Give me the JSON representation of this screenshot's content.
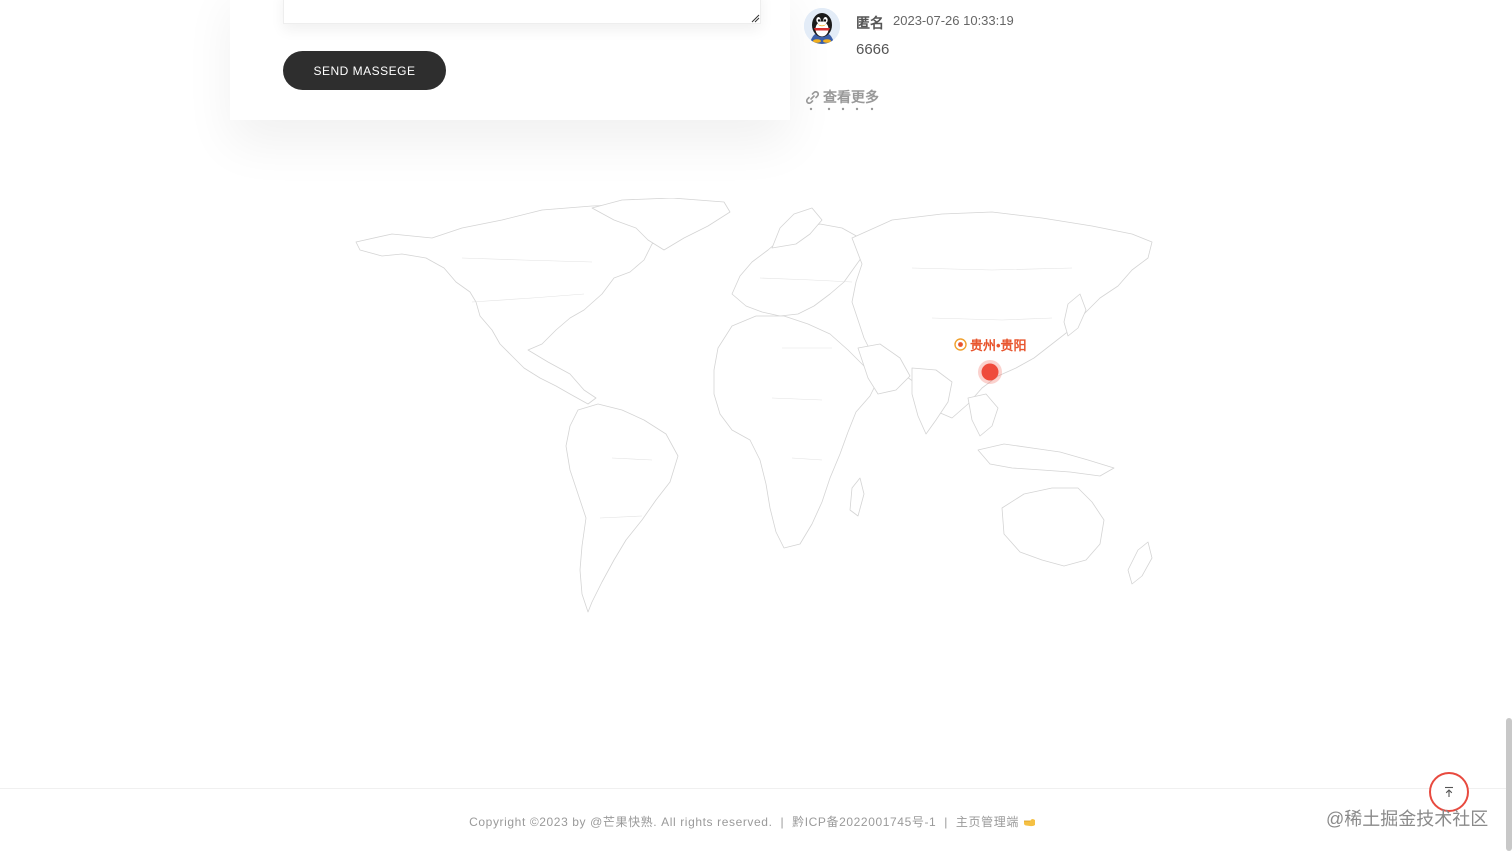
{
  "form": {
    "message_value": "",
    "send_label": "SEND MASSEGE"
  },
  "comment": {
    "author": "匿名",
    "time": "2023-07-26 10:33:19",
    "content": "6666"
  },
  "view_more": {
    "label": "查看更多",
    "icon": "link-icon"
  },
  "map": {
    "location_label": "贵州•贵阳",
    "marker_icon": "location-target-icon",
    "marker_color": "#ef4b3c",
    "label_color": "#e8552e"
  },
  "footer": {
    "copyright": "Copyright ©2023 by @芒果快熟. All rights reserved.",
    "separator": "|",
    "icp": "黔ICP备2022001745号-1",
    "admin_link": "主页管理端",
    "admin_icon": "pointing-hand-icon"
  },
  "back_to_top": {
    "icon": "arrow-up-to-top-icon",
    "color": "#e84a3f"
  },
  "watermark": "@稀土掘金技术社区"
}
